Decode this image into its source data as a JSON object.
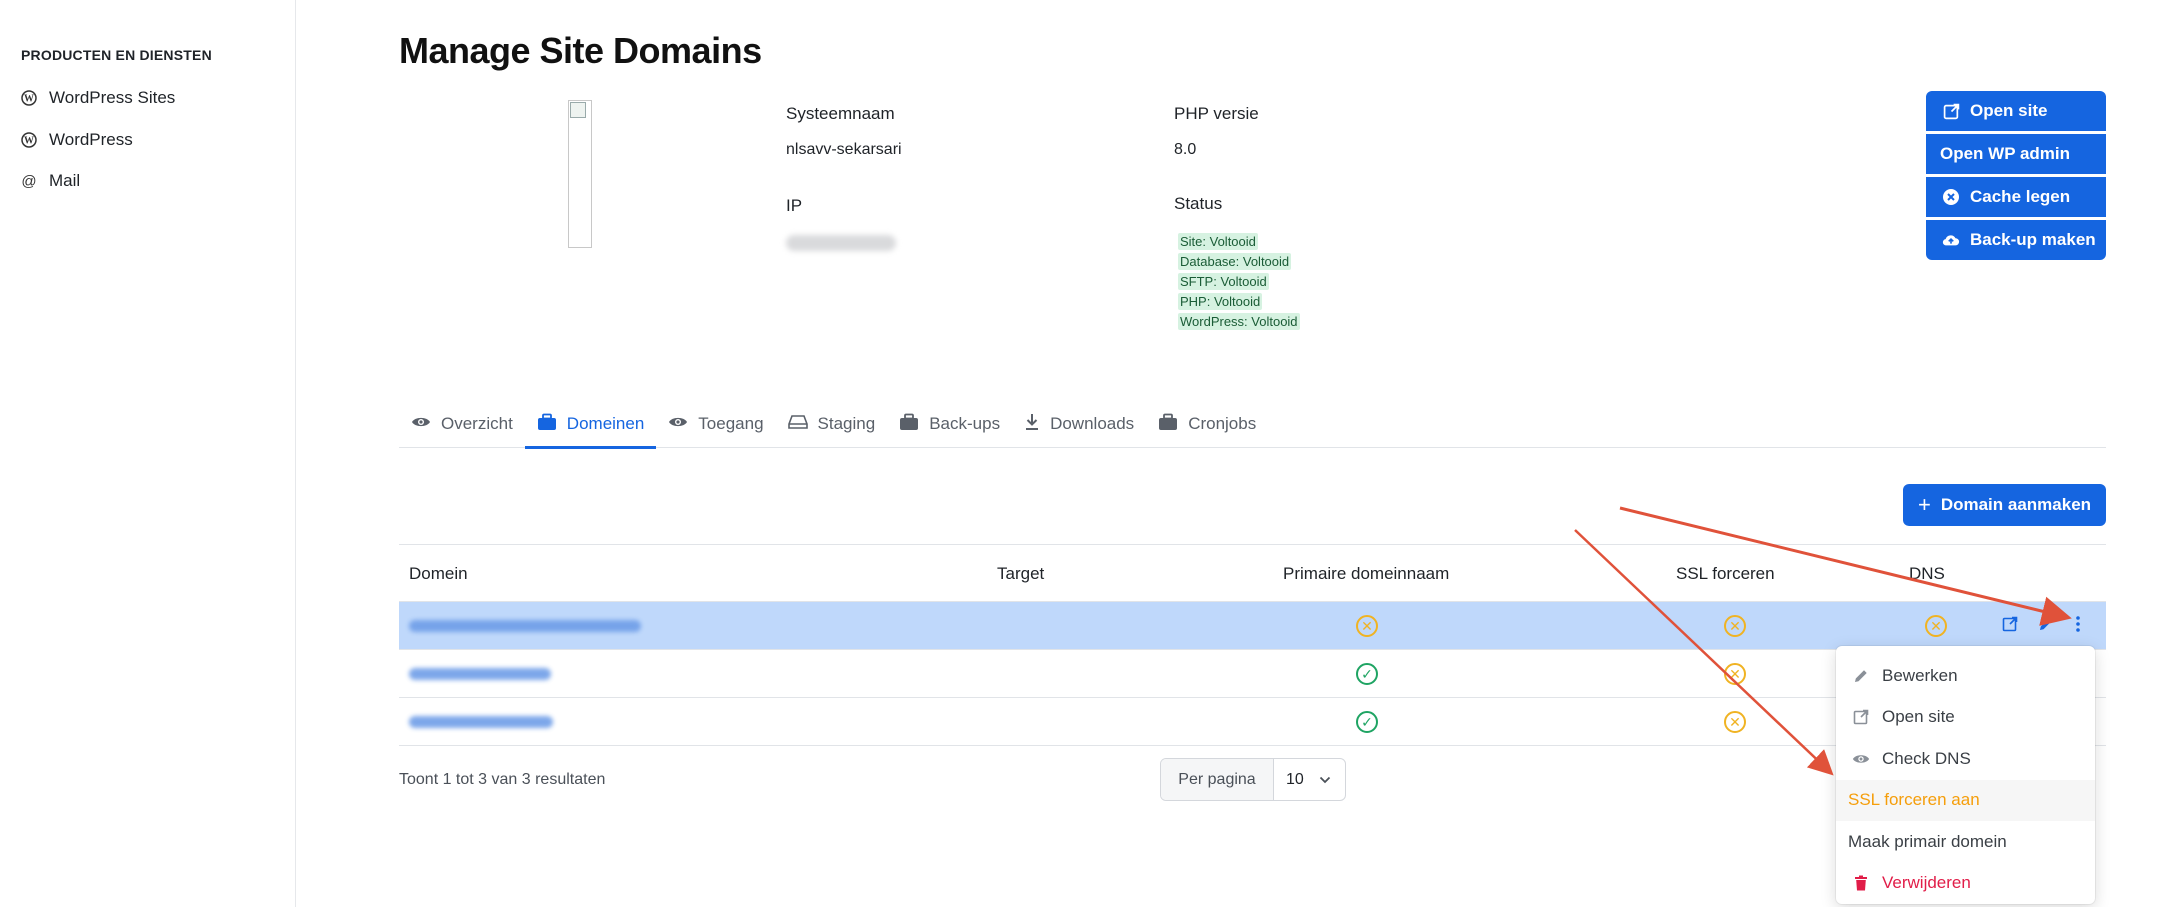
{
  "sidebar": {
    "heading": "PRODUCTEN EN DIENSTEN",
    "items": [
      {
        "label": "WordPress Sites",
        "icon": "wordpress-icon"
      },
      {
        "label": "WordPress",
        "icon": "wordpress-icon"
      },
      {
        "label": "Mail",
        "icon": "at-icon"
      }
    ]
  },
  "page": {
    "title": "Manage Site Domains"
  },
  "site_info": {
    "system_name_label": "Systeemnaam",
    "system_name_value": "nlsavv-sekarsari",
    "php_label": "PHP versie",
    "php_value": "8.0",
    "ip_label": "IP",
    "status_label": "Status",
    "status_items": [
      "Site: Voltooid",
      "Database: Voltooid",
      "SFTP: Voltooid",
      "PHP: Voltooid",
      "WordPress: Voltooid"
    ]
  },
  "actions": {
    "open_site": "Open site",
    "open_wp_admin": "Open WP admin",
    "clear_cache": "Cache legen",
    "backup": "Back-up maken"
  },
  "tabs": [
    {
      "label": "Overzicht",
      "icon": "eye-icon",
      "active": false
    },
    {
      "label": "Domeinen",
      "icon": "briefcase-icon",
      "active": true
    },
    {
      "label": "Toegang",
      "icon": "eye-icon",
      "active": false
    },
    {
      "label": "Staging",
      "icon": "drive-icon",
      "active": false
    },
    {
      "label": "Back-ups",
      "icon": "briefcase-icon",
      "active": false
    },
    {
      "label": "Downloads",
      "icon": "download-icon",
      "active": false
    },
    {
      "label": "Cronjobs",
      "icon": "briefcase-icon",
      "active": false
    }
  ],
  "add_domain_button": "Domain aanmaken",
  "table": {
    "headers": {
      "domain": "Domein",
      "target": "Target",
      "primary": "Primaire domeinnaam",
      "ssl": "SSL forceren",
      "dns": "DNS"
    },
    "rows": [
      {
        "primary": "no",
        "ssl": "no",
        "dns": "no",
        "selected": true
      },
      {
        "primary": "yes",
        "ssl": "no",
        "dns": "",
        "selected": false
      },
      {
        "primary": "yes",
        "ssl": "no",
        "dns": "",
        "selected": false
      }
    ]
  },
  "pagination": {
    "results_text": "Toont 1 tot 3 van 3 resultaten",
    "per_page_label": "Per pagina",
    "per_page_value": "10"
  },
  "context_menu": {
    "items": [
      {
        "label": "Bewerken",
        "icon": "pencil-icon"
      },
      {
        "label": "Open site",
        "icon": "external-link-icon"
      },
      {
        "label": "Check DNS",
        "icon": "eye-icon"
      },
      {
        "label": "SSL forceren aan",
        "icon": ""
      },
      {
        "label": "Maak primair domein",
        "icon": ""
      },
      {
        "label": "Verwijderen",
        "icon": "trash-icon"
      }
    ]
  },
  "colors": {
    "accent": "#1565e0",
    "warning": "#f0b323",
    "success": "#1fa463",
    "danger": "#e11d48",
    "annotation_arrow": "#e0523a"
  }
}
